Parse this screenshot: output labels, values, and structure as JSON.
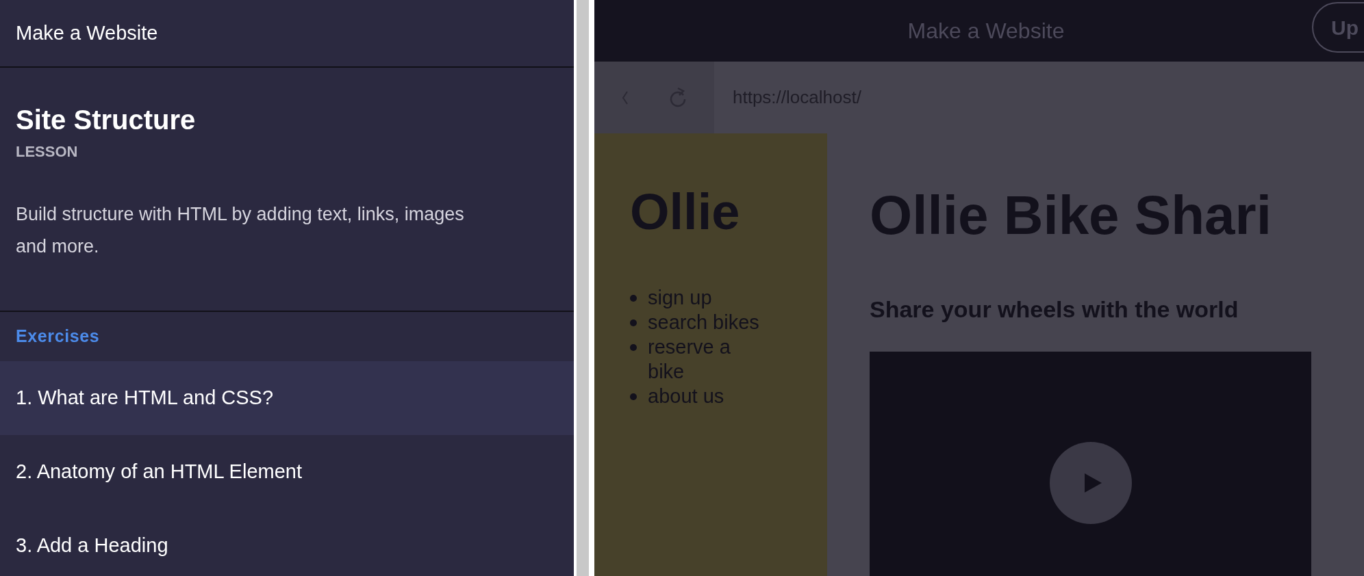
{
  "course_panel": {
    "course_title": "Make a Website",
    "lesson": {
      "title": "Site Structure",
      "type_label": "LESSON",
      "description": "Build structure with HTML by adding text, links, images and more."
    },
    "exercises_heading": "Exercises",
    "exercises": [
      {
        "label": "1. What are HTML and CSS?",
        "selected": true
      },
      {
        "label": "2. Anatomy of an HTML Element",
        "selected": false
      },
      {
        "label": "3. Add a Heading",
        "selected": false
      }
    ]
  },
  "workspace": {
    "title": "Make a Website",
    "button": "Up",
    "browser": {
      "url": "https://localhost/"
    },
    "page": {
      "logo": "Ollie",
      "nav_items": [
        "sign up",
        "search bikes",
        "reserve a bike",
        "about us"
      ],
      "heading": "Ollie Bike Shari",
      "subheading": "Share your wheels with the world"
    }
  }
}
